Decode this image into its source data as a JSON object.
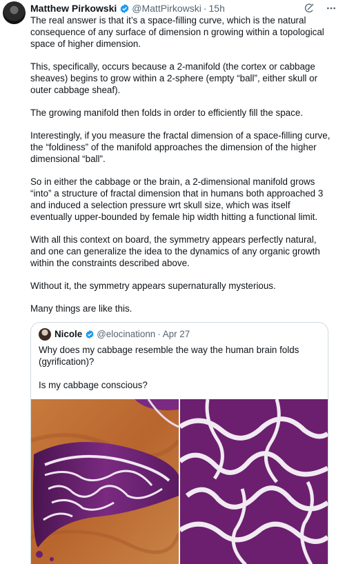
{
  "tweet": {
    "author_name": "Matthew Pirkowski",
    "author_handle": "@MattPirkowski",
    "time": "15h",
    "paragraphs": [
      "The real answer is that it’s a space-filling curve, which is the natural consequence of any surface of dimension n growing within a topological space of higher dimension.",
      "This, specifically, occurs because a 2-manifold (the cortex or cabbage sheaves) begins to grow within a 2-sphere (empty “ball”, either skull or outer cabbage sheaf).",
      "The growing manifold then folds in order to efficiently fill the space.",
      "Interestingly, if you measure the fractal dimension of a space-filling curve, the “foldiness” of the manifold approaches the dimension of the higher dimensional “ball”.",
      "So in either the cabbage or the brain, a 2-dimensional manifold grows “into” a structure of fractal dimension that in humans both approached 3 and induced a selection pressure wrt skull size, which was itself eventually upper-bounded by female hip width hitting a functional limit.",
      "With all this context on board, the symmetry appears perfectly natural, and one can generalize the idea to the dynamics of any organic growth within the constraints described above.",
      "Without it, the symmetry appears supernaturally mysterious.",
      "Many things are like this."
    ]
  },
  "quote": {
    "author_name": "Nicole",
    "author_handle": "@elocinationn",
    "date": "Apr 27",
    "paragraphs": [
      "Why does my cabbage resemble the  way the human brain folds (gyrification)?",
      "Is my cabbage conscious?"
    ]
  },
  "icons": {
    "verified": "verified-badge-icon",
    "grok": "grok-icon",
    "more": "more-icon"
  },
  "colors": {
    "verified_blue": "#1d9bf0",
    "muted_text": "#536471",
    "cabbage_purple": "#6b1f6e"
  }
}
